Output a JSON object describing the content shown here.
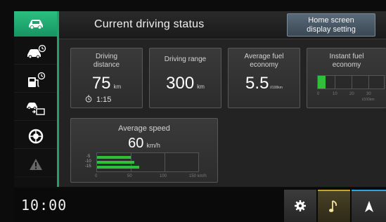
{
  "header": {
    "title": "Current driving status",
    "home_button_line1": "Home screen",
    "home_button_line2": "display setting"
  },
  "sidebar": {
    "items": [
      {
        "name": "driving-status",
        "icon": "car-icon",
        "active": true
      },
      {
        "name": "driving-history",
        "icon": "car-clock-icon",
        "active": false
      },
      {
        "name": "fuel-history",
        "icon": "fuel-clock-icon",
        "active": false
      },
      {
        "name": "eco-tips",
        "icon": "car-transfer-icon",
        "active": false
      },
      {
        "name": "tire-info",
        "icon": "tire-icon",
        "active": false
      },
      {
        "name": "warnings",
        "icon": "warning-icon",
        "active": false
      }
    ]
  },
  "cards": {
    "distance": {
      "title_line1": "Driving",
      "title_line2": "distance",
      "value": "75",
      "unit": "km",
      "time": "1:15",
      "time_icon": "stopwatch-icon"
    },
    "range": {
      "title": "Driving range",
      "value": "300",
      "unit": "km"
    },
    "avg_fuel": {
      "title_line1": "Average fuel",
      "title_line2": "economy",
      "value": "5.5",
      "unit": "l/100km"
    },
    "instant_fuel": {
      "title_line1": "Instant fuel",
      "title_line2": "economy",
      "ticks": [
        "0",
        "10",
        "20",
        "30"
      ],
      "unit": "l/100km",
      "fill_fraction": 0.12
    },
    "avg_speed": {
      "title": "Average speed",
      "value": "60",
      "unit": "km/h",
      "row_labels": [
        "-5",
        "-10",
        "-15"
      ],
      "row_values_kmh": [
        50,
        55,
        62
      ],
      "ticks": [
        "0",
        "50",
        "100",
        "150 km/h"
      ],
      "max_kmh": 150
    }
  },
  "footer": {
    "clock": "10:00",
    "buttons": [
      {
        "name": "settings",
        "icon": "gear-icon"
      },
      {
        "name": "audio",
        "icon": "music-note-icon"
      },
      {
        "name": "navigation",
        "icon": "navigation-arrow-icon"
      }
    ]
  },
  "colors": {
    "accent_green": "#1fa36b",
    "bar_green": "#2fbf3a",
    "panel": "#232323",
    "card": "#333333"
  }
}
